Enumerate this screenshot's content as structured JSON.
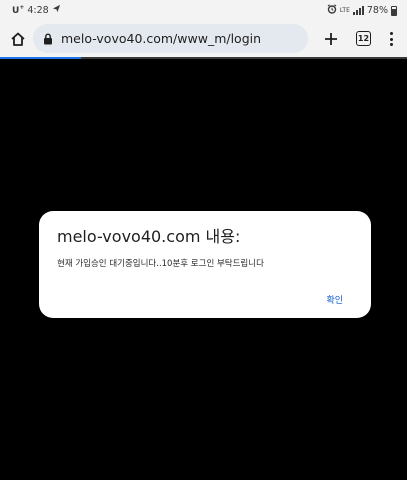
{
  "status_bar": {
    "carrier": "U",
    "carrier_plus": "+",
    "time": "4:28",
    "network": "LTE",
    "battery": "78%"
  },
  "toolbar": {
    "url": "melo-vovo40.com/www_m/login",
    "tab_count": "12"
  },
  "page_load_progress": 0.2,
  "dialog": {
    "title": "melo-vovo40.com 내용:",
    "message": "현재 가입승인 대기중입니다..10분후 로그인 부탁드립니다",
    "ok_label": "확인"
  },
  "colors": {
    "accent": "#0b57d0",
    "progress": "#1a73e8",
    "toolbar_bg": "#f3f3f3",
    "url_bar_bg": "#e4e9f0",
    "page_bg": "#000000"
  }
}
